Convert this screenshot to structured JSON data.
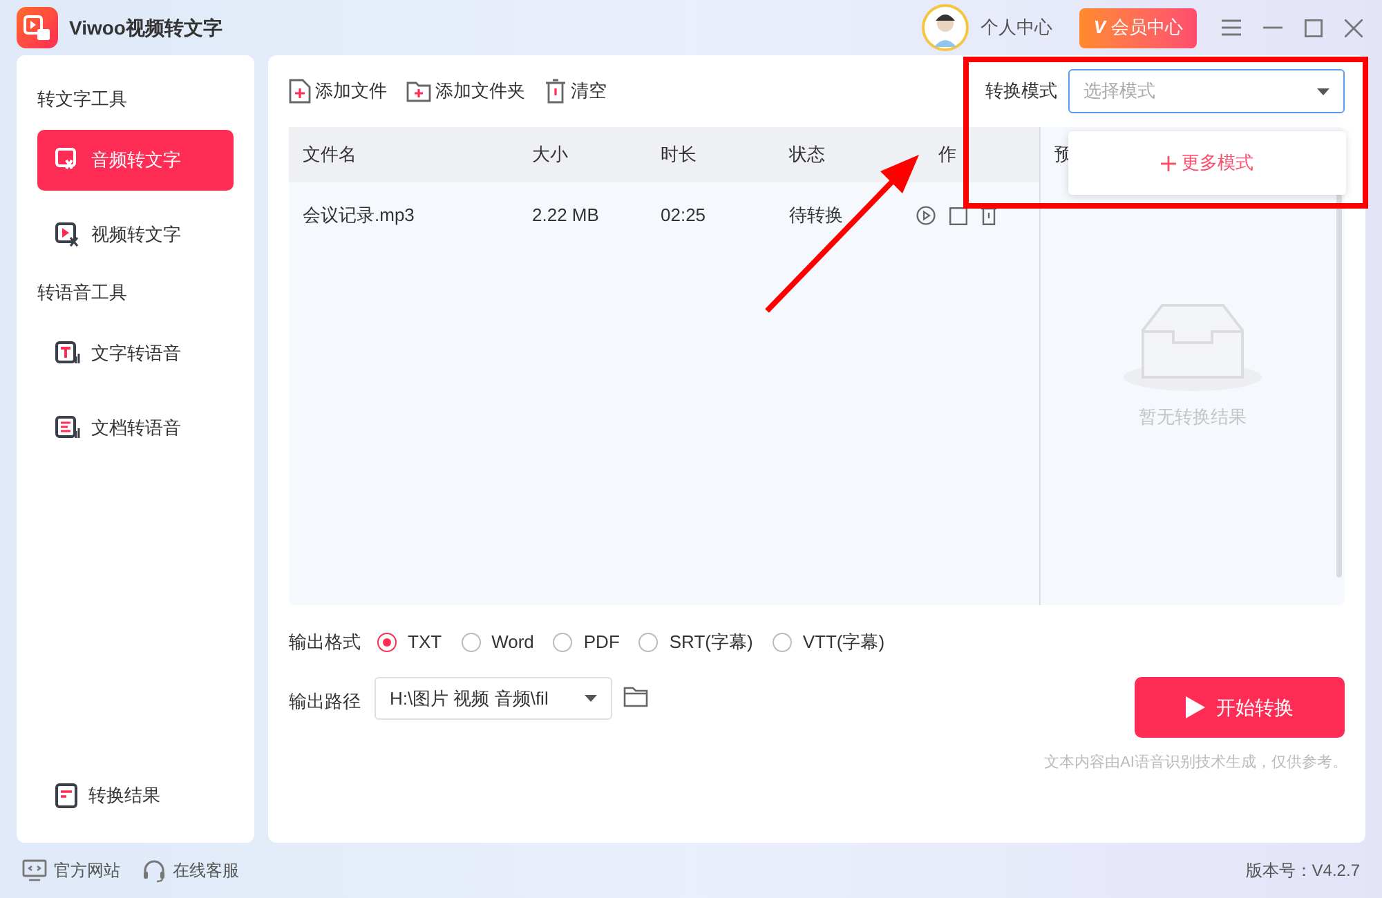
{
  "app": {
    "title": "Viwoo视频转文字"
  },
  "header": {
    "user": "个人中心",
    "vip_badge": "V",
    "vip": "会员中心"
  },
  "sidebar": {
    "sections": [
      {
        "title": "转文字工具",
        "items": [
          {
            "label": "音频转文字",
            "selected": true,
            "kind": "audio"
          },
          {
            "label": "视频转文字",
            "selected": false,
            "kind": "video"
          }
        ]
      },
      {
        "title": "转语音工具",
        "items": [
          {
            "label": "文字转语音",
            "selected": false,
            "kind": "text"
          },
          {
            "label": "文档转语音",
            "selected": false,
            "kind": "doc"
          }
        ]
      }
    ],
    "bottom_item": {
      "label": "转换结果"
    }
  },
  "toolbar": [
    {
      "label": "添加文件",
      "kind": "file"
    },
    {
      "label": "添加文件夹",
      "kind": "folder"
    },
    {
      "label": "清空",
      "kind": "trash"
    }
  ],
  "mode": {
    "label": "转换模式",
    "placeholder": "选择模式",
    "menu_item": "更多模式"
  },
  "table": {
    "columns": [
      "文件名",
      "大小",
      "时长",
      "状态",
      "作"
    ],
    "rows": [
      {
        "name": "会议记录.mp3",
        "size": "2.22 MB",
        "duration": "02:25",
        "status": "待转换"
      }
    ]
  },
  "preview": {
    "title": "预",
    "empty": "暂无转换结果"
  },
  "output": {
    "format_label": "输出格式",
    "formats": [
      {
        "label": "TXT",
        "selected": true
      },
      {
        "label": "Word",
        "selected": false
      },
      {
        "label": "PDF",
        "selected": false
      },
      {
        "label": "SRT(字幕)",
        "selected": false
      },
      {
        "label": "VTT(字幕)",
        "selected": false
      }
    ],
    "path_label": "输出路径",
    "path": "H:\\图片 视频 音频\\fil"
  },
  "start_button": "开始转换",
  "disclaimer": "文本内容由AI语音识别技术生成，仅供参考。",
  "footer": {
    "links": [
      {
        "label": "官方网站",
        "kind": "web"
      },
      {
        "label": "在线客服",
        "kind": "service"
      }
    ],
    "version": "版本号：V4.2.7"
  }
}
